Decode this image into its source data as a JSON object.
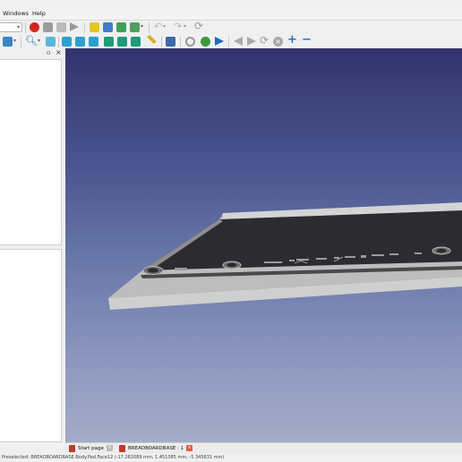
{
  "menubar": {
    "windows": "Windows",
    "help": "Help"
  },
  "toolbar": {
    "workbench_selector_icon": "dropdown-icon",
    "record_macro_icon": "record-icon",
    "stop_macro_icon": "stop-icon",
    "execute_macro_icon": "play-icon",
    "new_icon": "new-file-icon",
    "open_icon": "open-folder-icon",
    "undo_icon": "undo-icon",
    "redo_icon": "redo-icon",
    "refresh_icon": "refresh-icon"
  },
  "view_toolbar": {
    "views": [
      "fit-all",
      "zoom",
      "axonometric",
      "front",
      "top",
      "right",
      "rear",
      "bottom",
      "left"
    ],
    "nav": [
      "back",
      "forward",
      "sync",
      "stop",
      "add",
      "remove"
    ]
  },
  "panel": {
    "float_icon": "▫",
    "close_icon": "×"
  },
  "tabs": [
    {
      "label": "Start page"
    },
    {
      "label": "BREADBOARDBASE : 1"
    }
  ],
  "status": {
    "text": "Preselected: BREADBOARDBASE.Body.Pad.Face12 (-17.282089 mm, 1.451085 mm, -5.345631 mm)"
  },
  "colors": {
    "viewport_top": "#33336e",
    "viewport_bottom": "#a5abc8",
    "model_top": "#2a2a2e",
    "model_edge": "#d9d9d9",
    "accent_red": "#c0392b"
  }
}
